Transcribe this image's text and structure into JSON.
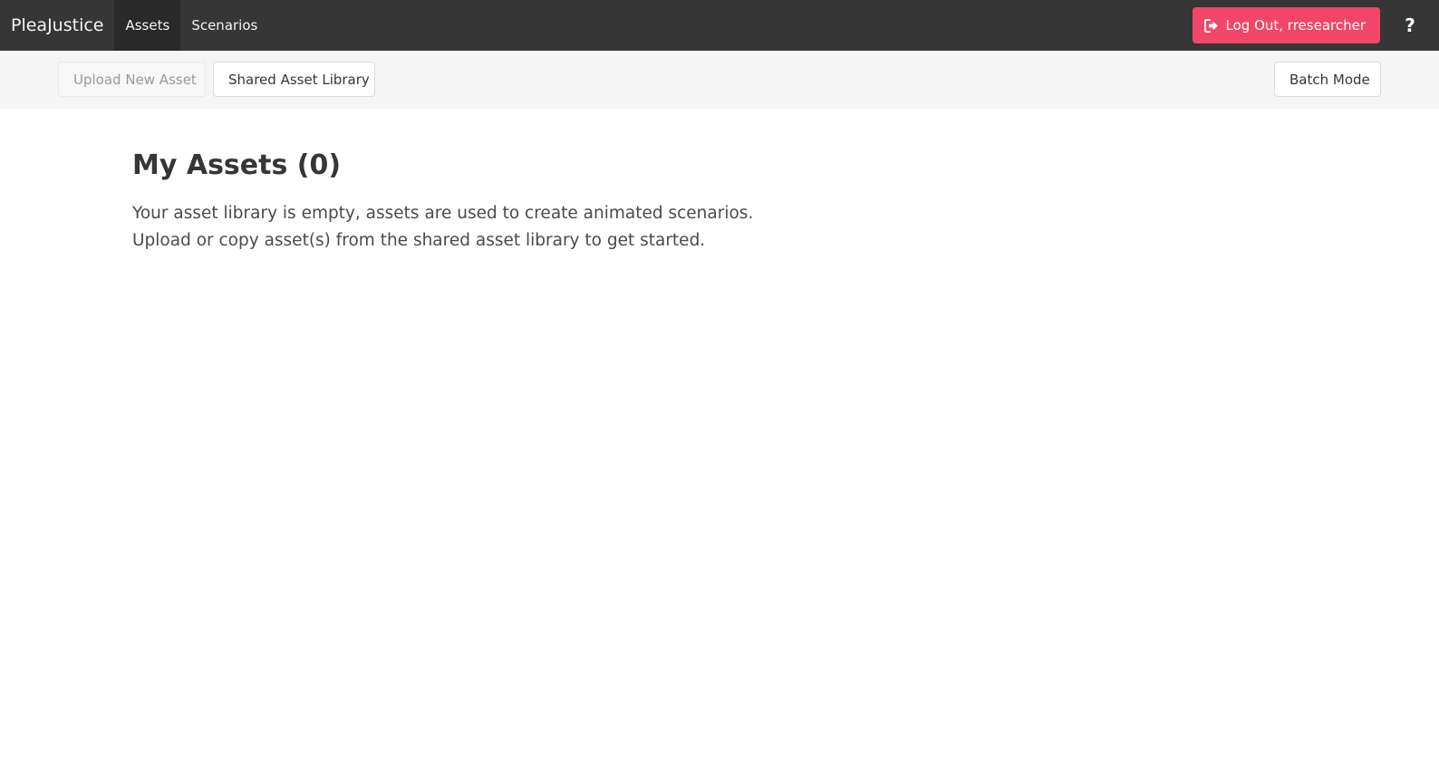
{
  "navbar": {
    "brand": "PleaJustice",
    "items": [
      {
        "label": "Assets",
        "active": true
      },
      {
        "label": "Scenarios",
        "active": false
      }
    ],
    "logout_label": "Log Out, rresearcher",
    "logout_icon": "sign-out-icon",
    "help_label": "?",
    "colors": {
      "background": "#363636",
      "active_item": "#292929",
      "logout": "#f14668"
    }
  },
  "toolbar": {
    "upload_label": "Upload New Asset",
    "upload_disabled": true,
    "shared_label": "Shared Asset Library",
    "batch_label": "Batch Mode"
  },
  "main": {
    "title": "My Assets (0)",
    "empty_line1": "Your asset library is empty, assets are used to create animated scenarios.",
    "empty_line2": "Upload or copy asset(s) from the shared asset library to get started."
  }
}
